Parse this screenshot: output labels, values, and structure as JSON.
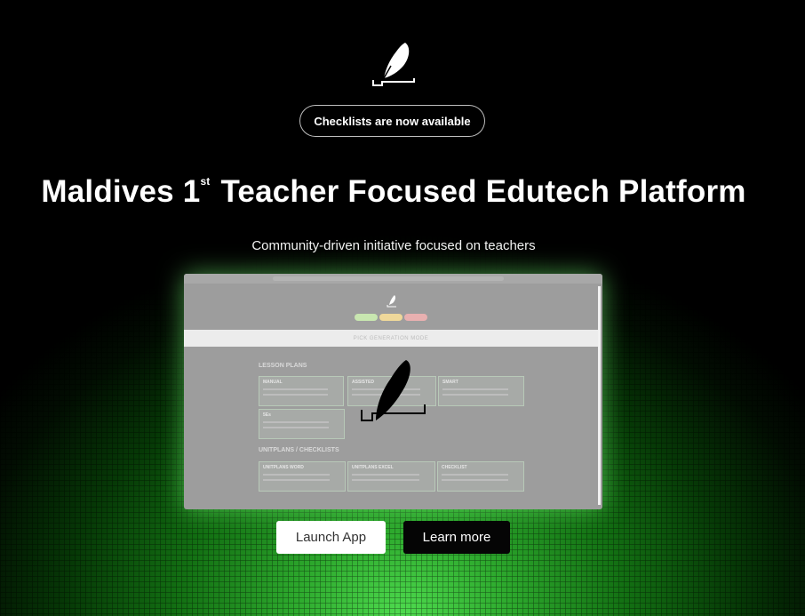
{
  "announcement": {
    "label": "Checklists are now available"
  },
  "hero": {
    "title_before": "Maldives 1",
    "title_sup": "st",
    "title_after": " Teacher Focused Edutech Platform",
    "subtitle": "Community-driven initiative focused on teachers"
  },
  "preview": {
    "mode_label": "PICK GENERATION MODE",
    "sections": [
      {
        "title": "LESSON PLANS",
        "cards": [
          "MANUAL",
          "ASSISTED",
          "SMART",
          "5Es"
        ]
      },
      {
        "title": "UNITPLANS / CHECKLISTS",
        "cards": [
          "UNITPLANS WORD",
          "UNITPLANS EXCEL",
          "CHECKLIST"
        ]
      }
    ],
    "chip_colors": [
      "#c8e6b0",
      "#efd89a",
      "#e8b0b0"
    ]
  },
  "actions": {
    "launch_label": "Launch App",
    "learn_label": "Learn more"
  },
  "colors": {
    "glow": "#4fdc4f",
    "background": "#000000"
  }
}
